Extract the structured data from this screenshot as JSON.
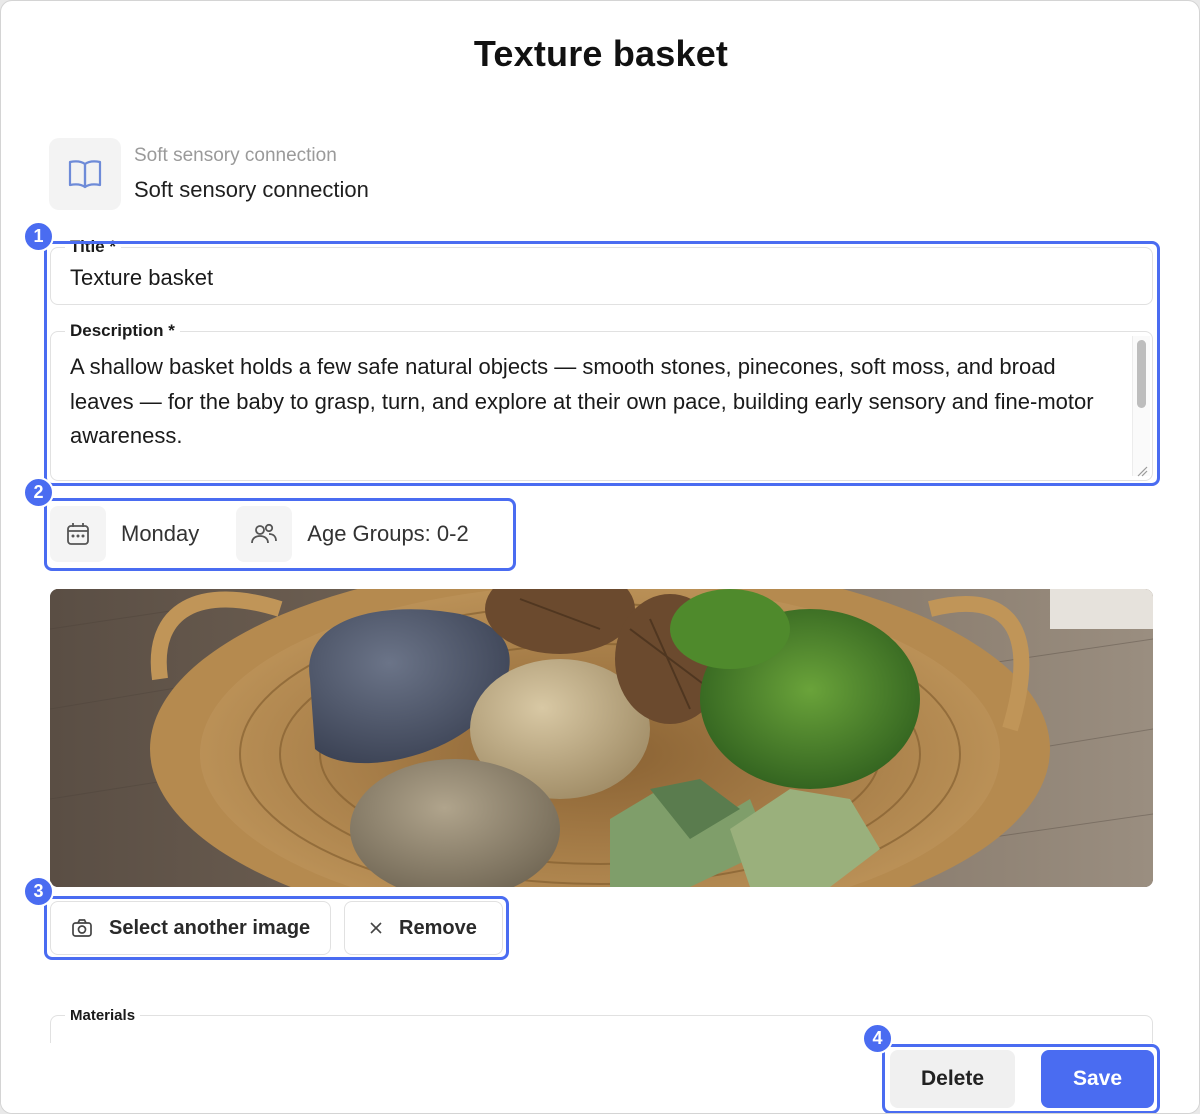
{
  "modal": {
    "title": "Texture basket"
  },
  "category": {
    "icon": "book-open-icon",
    "subtitle": "Soft sensory connection",
    "name": "Soft sensory connection"
  },
  "form": {
    "title_label": "Title *",
    "title_value": "Texture basket",
    "description_label": "Description *",
    "description_value": "A shallow basket holds a few safe natural objects — smooth stones, pinecones, soft moss, and broad leaves — for the baby to grasp, turn, and explore at their own pace, building early sensory and fine-motor awareness.",
    "materials_label": "Materials"
  },
  "meta": {
    "day_icon": "calendar-icon",
    "day": "Monday",
    "age_icon": "users-icon",
    "age_groups": "Age Groups: 0-2"
  },
  "image": {
    "content": "wicker basket with stones, pinecones, moss and leaves"
  },
  "image_actions": {
    "select_icon": "camera-icon",
    "select_label": "Select another image",
    "remove_icon": "close-icon",
    "remove_label": "Remove"
  },
  "footer": {
    "delete_label": "Delete",
    "save_label": "Save"
  },
  "annotations": {
    "labels": [
      "1",
      "2",
      "3",
      "4"
    ],
    "color": "#4a6cf1"
  },
  "colors": {
    "accent": "#4a6cf1",
    "muted_text": "#9a9a9a"
  }
}
